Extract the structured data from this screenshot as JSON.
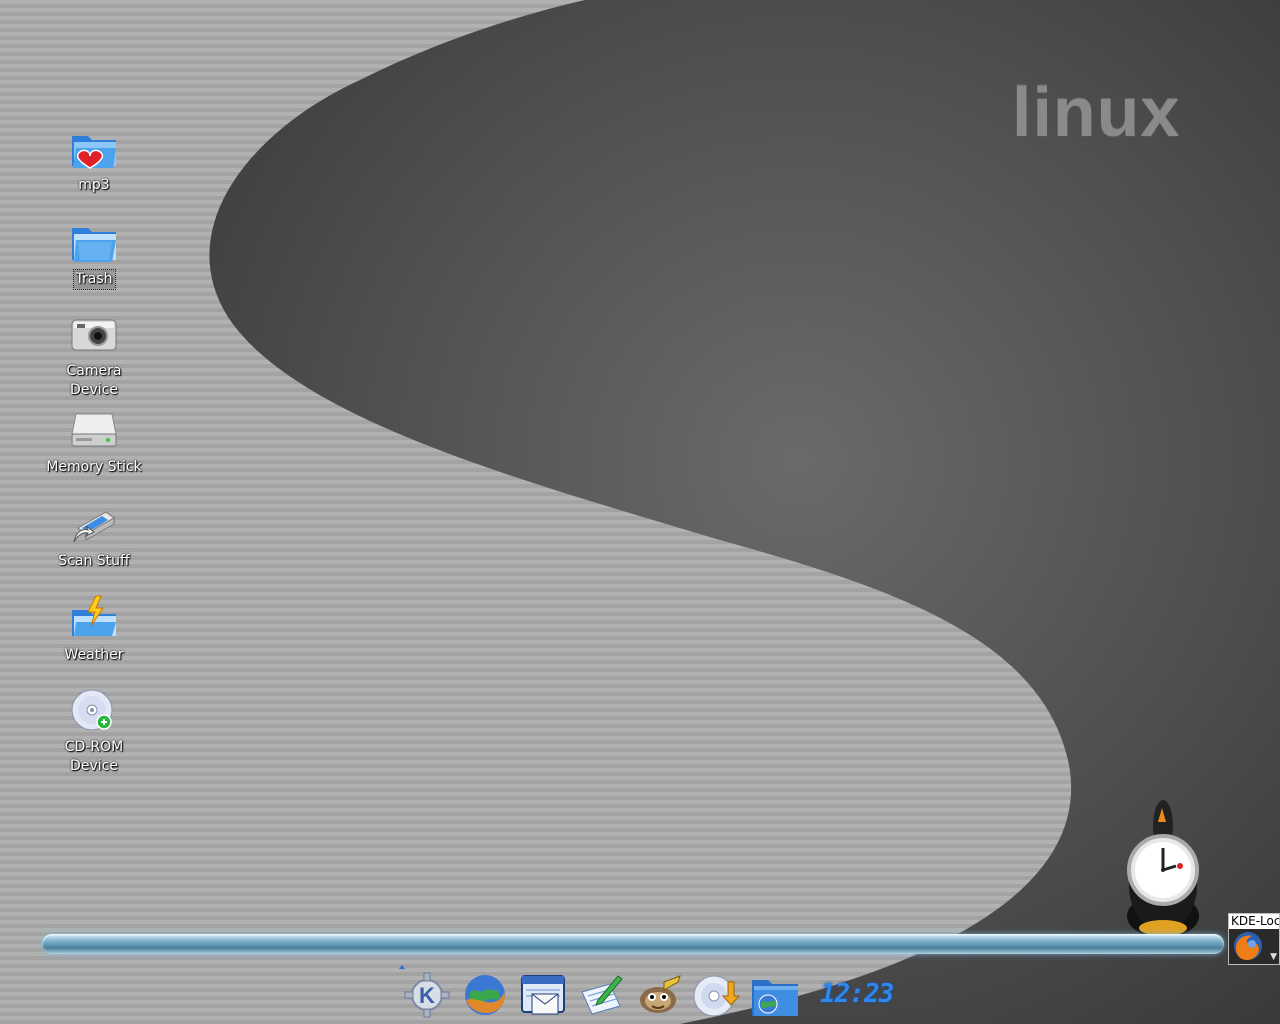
{
  "wallpaper": {
    "brand_text": "linux"
  },
  "desktop_icons": [
    {
      "id": "mp3",
      "label": "mp3",
      "icon": "folder-music-icon",
      "selected": false
    },
    {
      "id": "trash",
      "label": "Trash",
      "icon": "folder-trash-icon",
      "selected": true
    },
    {
      "id": "camera",
      "label": "Camera\nDevice",
      "icon": "camera-icon",
      "selected": false
    },
    {
      "id": "memory",
      "label": "Memory Stick",
      "icon": "removable-drive-icon",
      "selected": false
    },
    {
      "id": "scan",
      "label": "Scan Stuff",
      "icon": "scanner-icon",
      "selected": false
    },
    {
      "id": "weather",
      "label": "Weather",
      "icon": "weather-icon",
      "selected": false
    },
    {
      "id": "cdrom",
      "label": "CD-ROM\nDevice",
      "icon": "cdrom-icon",
      "selected": false
    }
  ],
  "tray": {
    "title": "KDE-Loc",
    "icon": "firefox-icon"
  },
  "dock": {
    "apps": [
      {
        "name": "kde-menu",
        "icon": "kde-logo-icon"
      },
      {
        "name": "web-browser",
        "icon": "globe-browser-icon"
      },
      {
        "name": "mail-client",
        "icon": "mail-calendar-icon"
      },
      {
        "name": "text-editor",
        "icon": "notepad-pencil-icon"
      },
      {
        "name": "gimp",
        "icon": "gimp-icon"
      },
      {
        "name": "cd-burner",
        "icon": "cd-burn-icon"
      },
      {
        "name": "file-manager",
        "icon": "folder-network-icon"
      }
    ],
    "clock_text": "12:23"
  },
  "colors": {
    "panel_glow": "#7fb2cc",
    "clock": "#2f87f0",
    "wallpaper_dark": "#4a4a4a",
    "wallpaper_light": "#a8a8a8"
  }
}
